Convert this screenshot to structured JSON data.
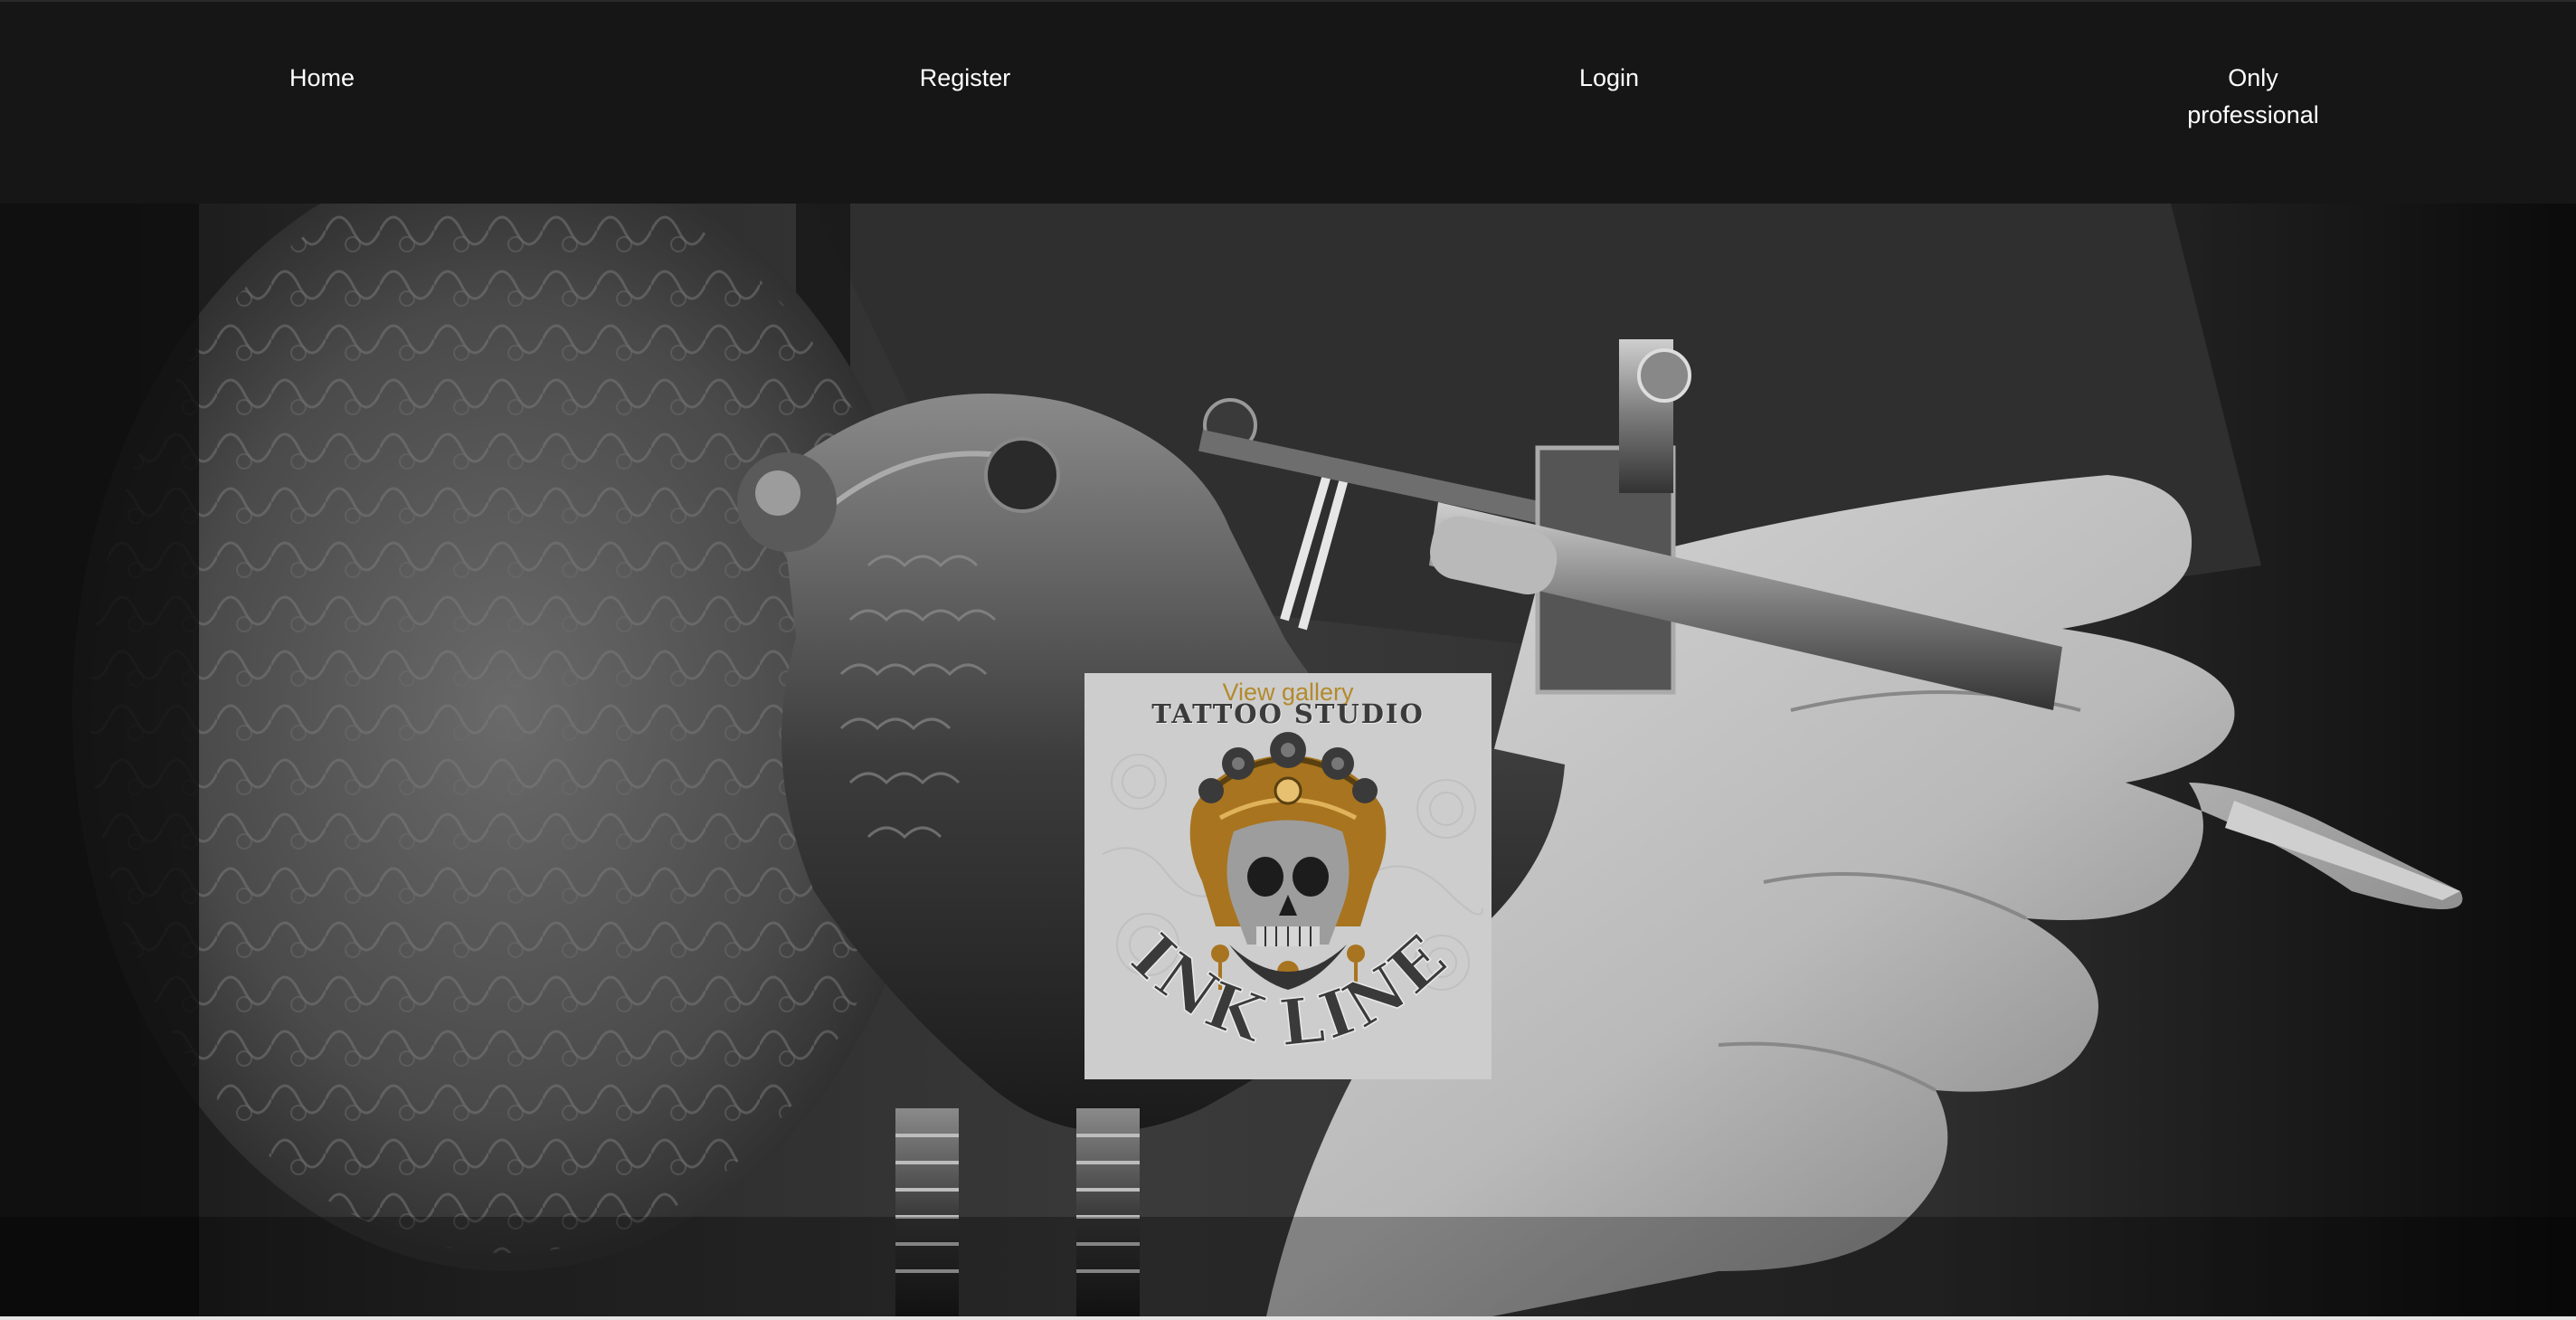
{
  "nav": {
    "home": "Home",
    "register": "Register",
    "login": "Login",
    "professional": "Only professional"
  },
  "logo": {
    "gallery_link": "View gallery",
    "top_text": "TATTOO STUDIO",
    "brand_name": "INK LINE"
  },
  "colors": {
    "nav_background": "#161616",
    "nav_text": "#ffffff",
    "gallery_link": "#b38a2c",
    "logo_card_background": "#cdcdcd",
    "skull_gold": "#a8741f"
  }
}
